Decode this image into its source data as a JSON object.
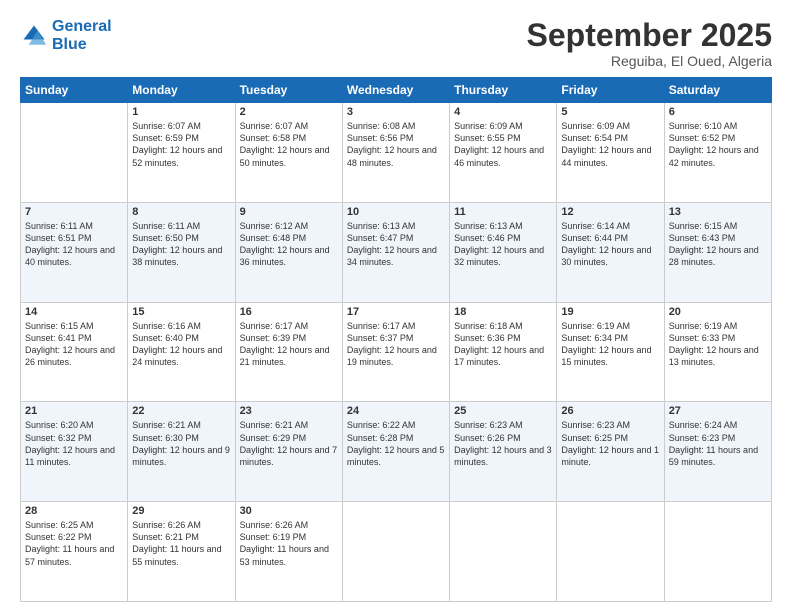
{
  "header": {
    "logo_line1": "General",
    "logo_line2": "Blue",
    "month": "September 2025",
    "location": "Reguiba, El Oued, Algeria"
  },
  "days_of_week": [
    "Sunday",
    "Monday",
    "Tuesday",
    "Wednesday",
    "Thursday",
    "Friday",
    "Saturday"
  ],
  "weeks": [
    [
      {
        "day": "",
        "sunrise": "",
        "sunset": "",
        "daylight": ""
      },
      {
        "day": "1",
        "sunrise": "Sunrise: 6:07 AM",
        "sunset": "Sunset: 6:59 PM",
        "daylight": "Daylight: 12 hours and 52 minutes."
      },
      {
        "day": "2",
        "sunrise": "Sunrise: 6:07 AM",
        "sunset": "Sunset: 6:58 PM",
        "daylight": "Daylight: 12 hours and 50 minutes."
      },
      {
        "day": "3",
        "sunrise": "Sunrise: 6:08 AM",
        "sunset": "Sunset: 6:56 PM",
        "daylight": "Daylight: 12 hours and 48 minutes."
      },
      {
        "day": "4",
        "sunrise": "Sunrise: 6:09 AM",
        "sunset": "Sunset: 6:55 PM",
        "daylight": "Daylight: 12 hours and 46 minutes."
      },
      {
        "day": "5",
        "sunrise": "Sunrise: 6:09 AM",
        "sunset": "Sunset: 6:54 PM",
        "daylight": "Daylight: 12 hours and 44 minutes."
      },
      {
        "day": "6",
        "sunrise": "Sunrise: 6:10 AM",
        "sunset": "Sunset: 6:52 PM",
        "daylight": "Daylight: 12 hours and 42 minutes."
      }
    ],
    [
      {
        "day": "7",
        "sunrise": "Sunrise: 6:11 AM",
        "sunset": "Sunset: 6:51 PM",
        "daylight": "Daylight: 12 hours and 40 minutes."
      },
      {
        "day": "8",
        "sunrise": "Sunrise: 6:11 AM",
        "sunset": "Sunset: 6:50 PM",
        "daylight": "Daylight: 12 hours and 38 minutes."
      },
      {
        "day": "9",
        "sunrise": "Sunrise: 6:12 AM",
        "sunset": "Sunset: 6:48 PM",
        "daylight": "Daylight: 12 hours and 36 minutes."
      },
      {
        "day": "10",
        "sunrise": "Sunrise: 6:13 AM",
        "sunset": "Sunset: 6:47 PM",
        "daylight": "Daylight: 12 hours and 34 minutes."
      },
      {
        "day": "11",
        "sunrise": "Sunrise: 6:13 AM",
        "sunset": "Sunset: 6:46 PM",
        "daylight": "Daylight: 12 hours and 32 minutes."
      },
      {
        "day": "12",
        "sunrise": "Sunrise: 6:14 AM",
        "sunset": "Sunset: 6:44 PM",
        "daylight": "Daylight: 12 hours and 30 minutes."
      },
      {
        "day": "13",
        "sunrise": "Sunrise: 6:15 AM",
        "sunset": "Sunset: 6:43 PM",
        "daylight": "Daylight: 12 hours and 28 minutes."
      }
    ],
    [
      {
        "day": "14",
        "sunrise": "Sunrise: 6:15 AM",
        "sunset": "Sunset: 6:41 PM",
        "daylight": "Daylight: 12 hours and 26 minutes."
      },
      {
        "day": "15",
        "sunrise": "Sunrise: 6:16 AM",
        "sunset": "Sunset: 6:40 PM",
        "daylight": "Daylight: 12 hours and 24 minutes."
      },
      {
        "day": "16",
        "sunrise": "Sunrise: 6:17 AM",
        "sunset": "Sunset: 6:39 PM",
        "daylight": "Daylight: 12 hours and 21 minutes."
      },
      {
        "day": "17",
        "sunrise": "Sunrise: 6:17 AM",
        "sunset": "Sunset: 6:37 PM",
        "daylight": "Daylight: 12 hours and 19 minutes."
      },
      {
        "day": "18",
        "sunrise": "Sunrise: 6:18 AM",
        "sunset": "Sunset: 6:36 PM",
        "daylight": "Daylight: 12 hours and 17 minutes."
      },
      {
        "day": "19",
        "sunrise": "Sunrise: 6:19 AM",
        "sunset": "Sunset: 6:34 PM",
        "daylight": "Daylight: 12 hours and 15 minutes."
      },
      {
        "day": "20",
        "sunrise": "Sunrise: 6:19 AM",
        "sunset": "Sunset: 6:33 PM",
        "daylight": "Daylight: 12 hours and 13 minutes."
      }
    ],
    [
      {
        "day": "21",
        "sunrise": "Sunrise: 6:20 AM",
        "sunset": "Sunset: 6:32 PM",
        "daylight": "Daylight: 12 hours and 11 minutes."
      },
      {
        "day": "22",
        "sunrise": "Sunrise: 6:21 AM",
        "sunset": "Sunset: 6:30 PM",
        "daylight": "Daylight: 12 hours and 9 minutes."
      },
      {
        "day": "23",
        "sunrise": "Sunrise: 6:21 AM",
        "sunset": "Sunset: 6:29 PM",
        "daylight": "Daylight: 12 hours and 7 minutes."
      },
      {
        "day": "24",
        "sunrise": "Sunrise: 6:22 AM",
        "sunset": "Sunset: 6:28 PM",
        "daylight": "Daylight: 12 hours and 5 minutes."
      },
      {
        "day": "25",
        "sunrise": "Sunrise: 6:23 AM",
        "sunset": "Sunset: 6:26 PM",
        "daylight": "Daylight: 12 hours and 3 minutes."
      },
      {
        "day": "26",
        "sunrise": "Sunrise: 6:23 AM",
        "sunset": "Sunset: 6:25 PM",
        "daylight": "Daylight: 12 hours and 1 minute."
      },
      {
        "day": "27",
        "sunrise": "Sunrise: 6:24 AM",
        "sunset": "Sunset: 6:23 PM",
        "daylight": "Daylight: 11 hours and 59 minutes."
      }
    ],
    [
      {
        "day": "28",
        "sunrise": "Sunrise: 6:25 AM",
        "sunset": "Sunset: 6:22 PM",
        "daylight": "Daylight: 11 hours and 57 minutes."
      },
      {
        "day": "29",
        "sunrise": "Sunrise: 6:26 AM",
        "sunset": "Sunset: 6:21 PM",
        "daylight": "Daylight: 11 hours and 55 minutes."
      },
      {
        "day": "30",
        "sunrise": "Sunrise: 6:26 AM",
        "sunset": "Sunset: 6:19 PM",
        "daylight": "Daylight: 11 hours and 53 minutes."
      },
      {
        "day": "",
        "sunrise": "",
        "sunset": "",
        "daylight": ""
      },
      {
        "day": "",
        "sunrise": "",
        "sunset": "",
        "daylight": ""
      },
      {
        "day": "",
        "sunrise": "",
        "sunset": "",
        "daylight": ""
      },
      {
        "day": "",
        "sunrise": "",
        "sunset": "",
        "daylight": ""
      }
    ]
  ]
}
